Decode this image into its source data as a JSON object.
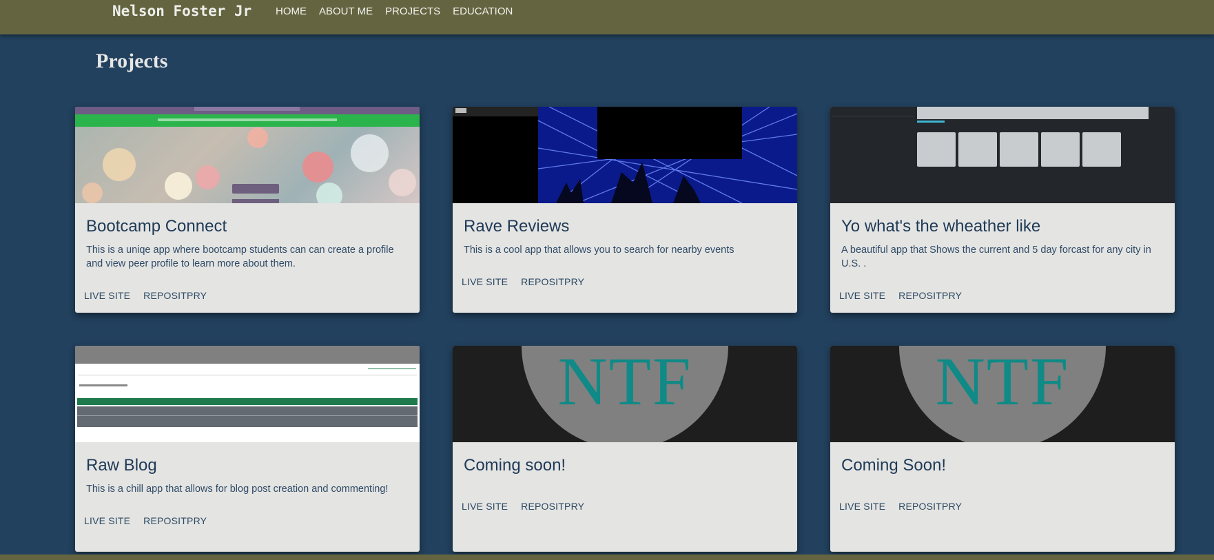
{
  "nav": {
    "brand": "Nelson Foster Jr",
    "links": [
      "HOME",
      "ABOUT ME",
      "PROJECTS",
      "EDUCATION"
    ]
  },
  "page_title": "Projects",
  "cards": [
    {
      "title": "Bootcamp Connect",
      "description": "This is a uniqe app where bootcamp students can can create a profile and view peer profile to learn more about them.",
      "live_label": "LIVE SITE",
      "repo_label": "REPOSITPRY"
    },
    {
      "title": "Rave Reviews",
      "description": "This is a cool app that allows you to search for nearby events",
      "live_label": "LIVE SITE",
      "repo_label": "REPOSITPRY"
    },
    {
      "title": "Yo what's the wheather like",
      "description": "A beautiful app that Shows the current and 5 day forcast for any city in U.S. .",
      "live_label": "LIVE SITE",
      "repo_label": "REPOSITPRY"
    },
    {
      "title": "Raw Blog",
      "description": "This is a chill app that allows for blog post creation and commenting!",
      "live_label": "LIVE SITE",
      "repo_label": "REPOSITPRY"
    },
    {
      "title": "Coming soon!",
      "description": "",
      "live_label": "LIVE SITE",
      "repo_label": "REPOSITPRY",
      "image_text": "NTF"
    },
    {
      "title": "Coming Soon!",
      "description": "",
      "live_label": "LIVE SITE",
      "repo_label": "REPOSITPRY",
      "image_text": "NTF"
    }
  ],
  "colors": {
    "navbar": "#646540",
    "background": "#22415e",
    "card": "#e4e4e2",
    "ntf_text": "#0f8a86"
  }
}
